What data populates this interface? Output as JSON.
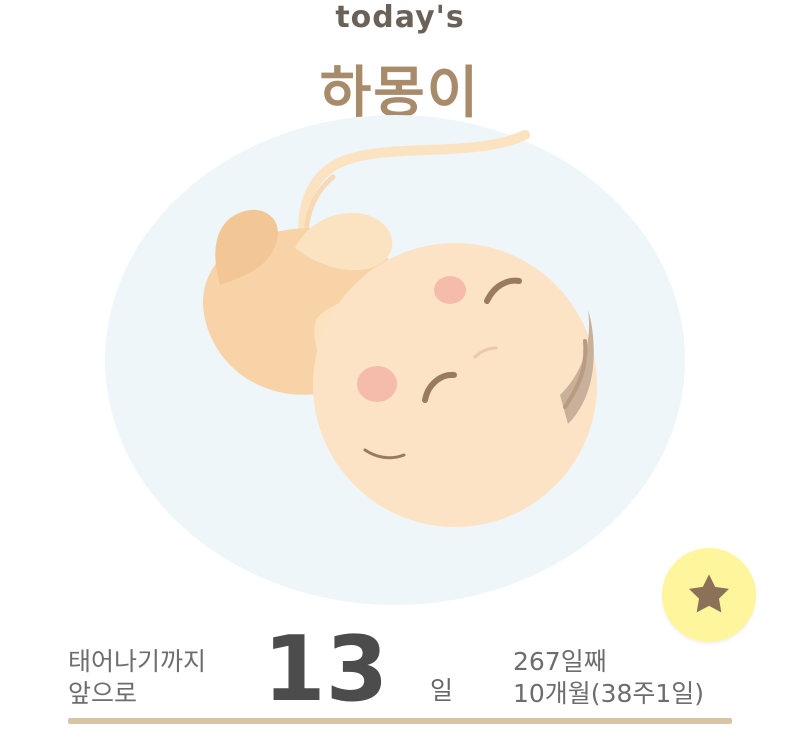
{
  "header": {
    "kicker": "today's",
    "title": "하몽이"
  },
  "illustration": {
    "alt": "sleeping baby illustration",
    "colors": {
      "background": "#eef6f9",
      "skin": "#f7d3a7",
      "skin_light": "#fbe3c2",
      "hair": "#c9b09a",
      "blush": "#f3b1a4",
      "eyes": "#9a7b5f"
    }
  },
  "favorite": {
    "icon": "star-icon",
    "background": "#fff59c",
    "icon_color": "#8a7158"
  },
  "countdown": {
    "line1": "태어나기까지",
    "line2": "앞으로",
    "number": "13",
    "unit": "일"
  },
  "pregnancy": {
    "day": "267일째",
    "month_week": "10개월(38주1일)"
  },
  "divider": {
    "color": "#d7c5a6"
  }
}
